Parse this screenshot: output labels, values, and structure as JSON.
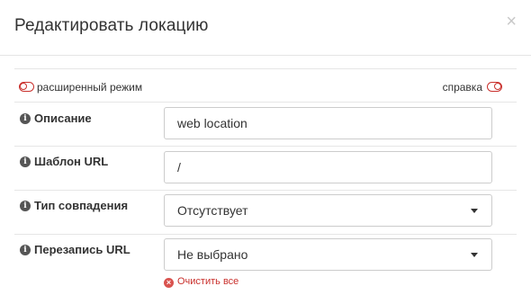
{
  "dialog": {
    "title": "Редактировать локацию",
    "close_symbol": "×"
  },
  "toolbar": {
    "advanced_mode_label": "расширенный режим",
    "help_label": "справка"
  },
  "fields": {
    "description": {
      "label": "Описание",
      "value": "web location"
    },
    "url_pattern": {
      "label": "Шаблон URL",
      "value": "/"
    },
    "match_type": {
      "label": "Тип совпадения",
      "selected": "Отсутствует"
    },
    "url_rewrite": {
      "label": "Перезапись URL",
      "selected": "Не выбрано",
      "clear_all_label": "Очистить все"
    }
  },
  "icons": {
    "info": "info-icon",
    "toggle": "toggle-icon",
    "close": "close-icon",
    "caret": "chevron-down-icon",
    "clear": "clear-icon"
  },
  "colors": {
    "accent_red": "#c9302c",
    "border": "#cccccc",
    "divider": "#e6e6e6"
  }
}
